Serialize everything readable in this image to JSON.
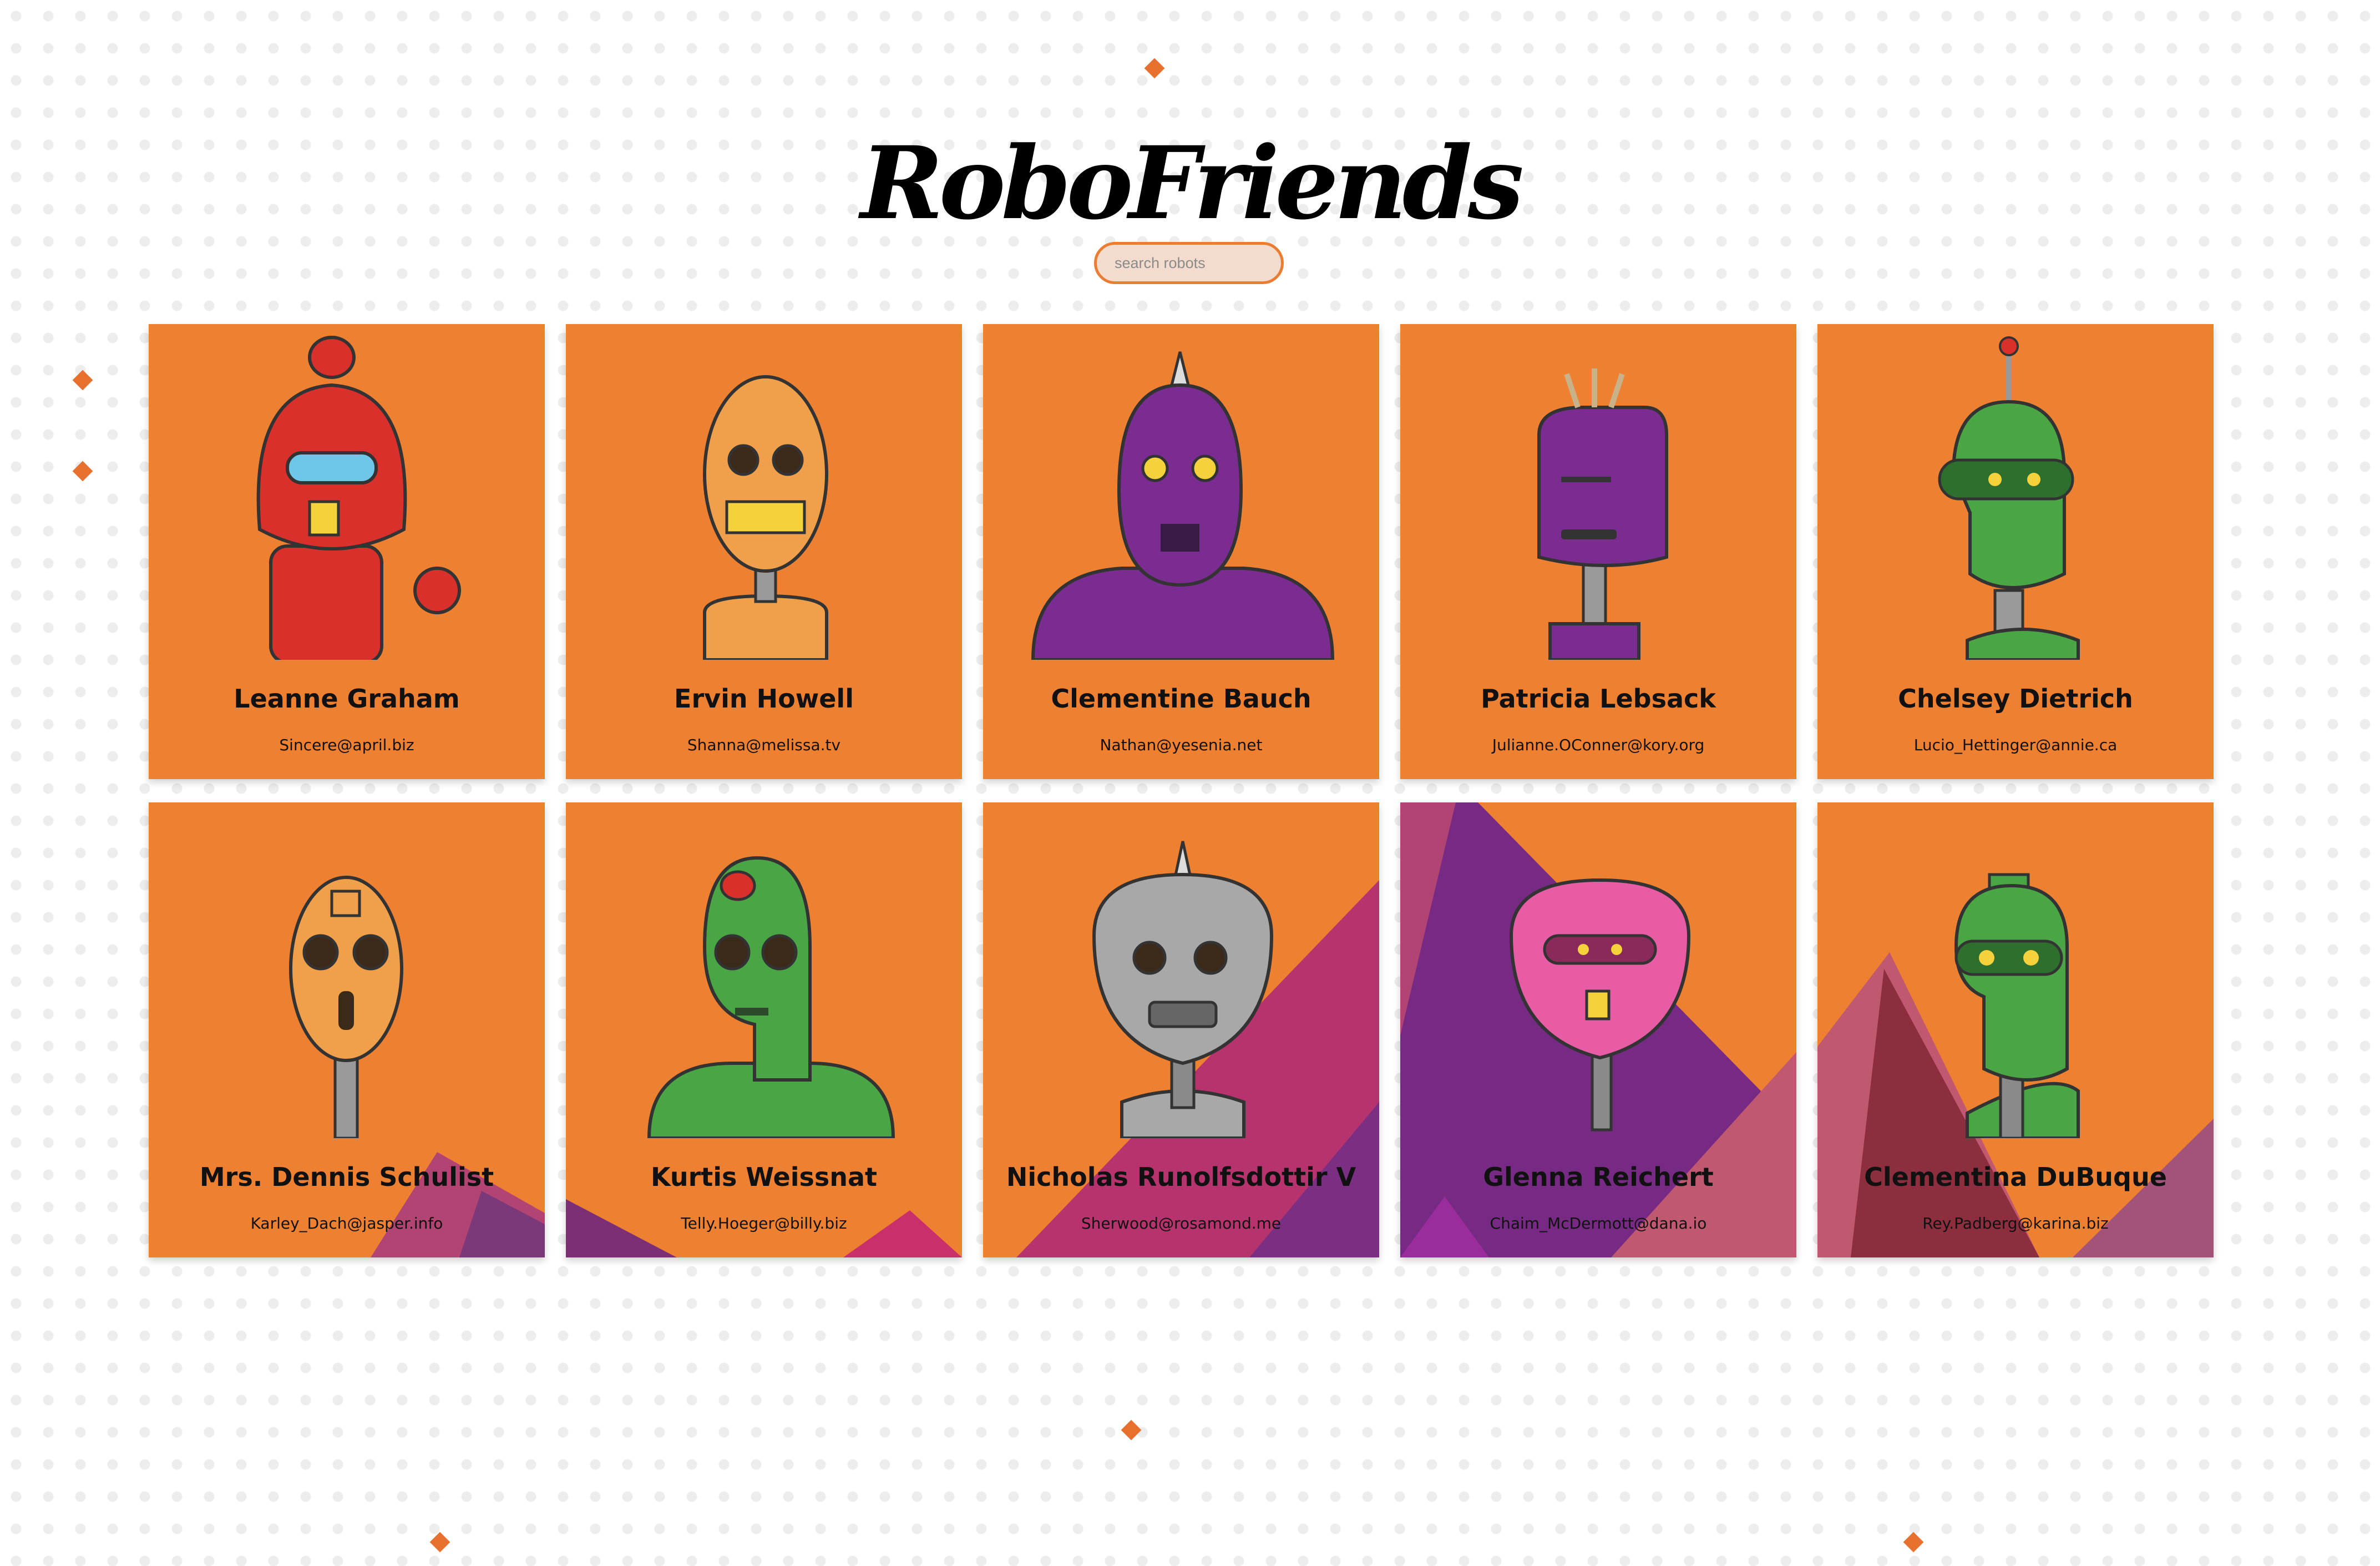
{
  "header": {
    "title": "RoboFriends"
  },
  "search": {
    "placeholder": "search robots",
    "value": ""
  },
  "robots": [
    {
      "name": "Leanne Graham",
      "email": "Sincere@april.biz",
      "color": "#d9302c"
    },
    {
      "name": "Ervin Howell",
      "email": "Shanna@melissa.tv",
      "color": "#f0a04a"
    },
    {
      "name": "Clementine Bauch",
      "email": "Nathan@yesenia.net",
      "color": "#7b2c91"
    },
    {
      "name": "Patricia Lebsack",
      "email": "Julianne.OConner@kory.org",
      "color": "#7b2c91"
    },
    {
      "name": "Chelsey Dietrich",
      "email": "Lucio_Hettinger@annie.ca",
      "color": "#4aa544"
    },
    {
      "name": "Mrs. Dennis Schulist",
      "email": "Karley_Dach@jasper.info",
      "color": "#f0a04a"
    },
    {
      "name": "Kurtis Weissnat",
      "email": "Telly.Hoeger@billy.biz",
      "color": "#4aa544"
    },
    {
      "name": "Nicholas Runolfsdottir V",
      "email": "Sherwood@rosamond.me",
      "color": "#a8a8a8"
    },
    {
      "name": "Glenna Reichert",
      "email": "Chaim_McDermott@dana.io",
      "color": "#e85ca5"
    },
    {
      "name": "Clementina DuBuque",
      "email": "Rey.Padberg@karina.biz",
      "color": "#4aa544"
    }
  ]
}
